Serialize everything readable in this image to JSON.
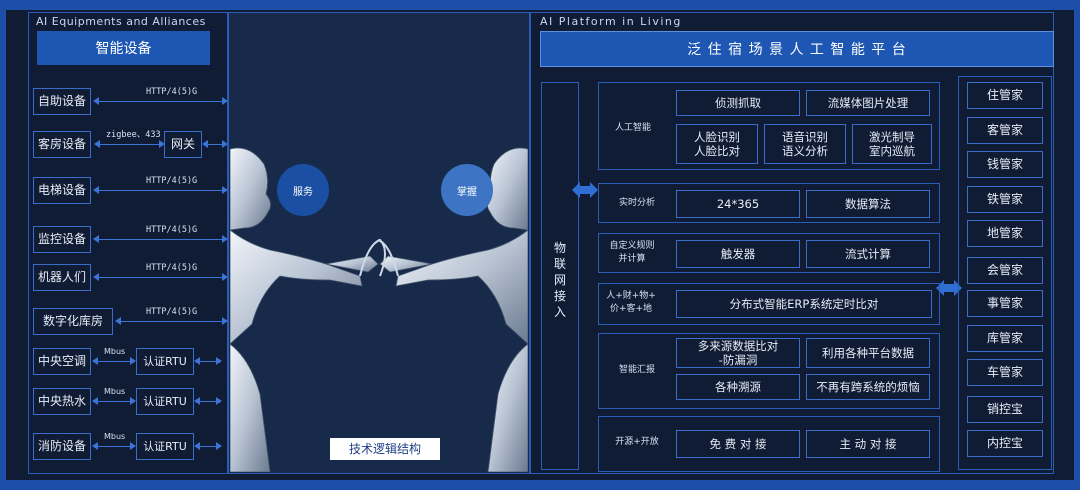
{
  "left": {
    "caption": "AI  Equipments and Alliances",
    "title": "智能设备",
    "devices": [
      {
        "label": "自助设备",
        "proto": "HTTP/4(5)G"
      },
      {
        "label": "客房设备",
        "proto": "zigbee、433"
      },
      {
        "label": "电梯设备",
        "proto": "HTTP/4(5)G"
      },
      {
        "label": "监控设备",
        "proto": "HTTP/4(5)G"
      },
      {
        "label": "机器人们",
        "proto": "HTTP/4(5)G"
      },
      {
        "label": "数字化库房",
        "proto": "HTTP/4(5)G"
      },
      {
        "label": "中央空调",
        "proto": "Mbus"
      },
      {
        "label": "中央热水",
        "proto": "Mbus"
      },
      {
        "label": "消防设备",
        "proto": "Mbus"
      }
    ],
    "gateway": "网关",
    "rtu": "认证RTU"
  },
  "middle": {
    "circle_left": "服务",
    "circle_right": "掌握",
    "footer": "技术逻辑结构"
  },
  "right": {
    "caption": "AI Platform  in Living",
    "title": "泛 住 宿 场 景 人 工 智 能 平 台",
    "iot": "物联网接入",
    "sections": [
      {
        "label": "人工智能",
        "cells": [
          "侦测抓取",
          "流媒体图片处理",
          "人脸识别\n人脸比对",
          "语音识别\n语义分析",
          "激光制导\n室内巡航"
        ]
      },
      {
        "label": "实时分析",
        "cells": [
          "24*365",
          "数据算法"
        ]
      },
      {
        "label": "自定义规则\n并计算",
        "cells": [
          "触发器",
          "流式计算"
        ]
      },
      {
        "label": "人+财+物+\n价+客+地",
        "cells": [
          "分布式智能ERP系统定时比对"
        ]
      },
      {
        "label": "智能汇报",
        "cells": [
          "多来源数据比对\n-防漏洞",
          "利用各种平台数据",
          "各种溯源",
          "不再有跨系统的烦恼"
        ]
      },
      {
        "label": "开源+开放",
        "cells": [
          "免 费 对 接",
          "主 动 对 接"
        ]
      }
    ],
    "managers": [
      "住管家",
      "客管家",
      "钱管家",
      "铁管家",
      "地管家",
      "会管家",
      "事管家",
      "库管家",
      "车管家",
      "销控宝",
      "内控宝"
    ]
  }
}
